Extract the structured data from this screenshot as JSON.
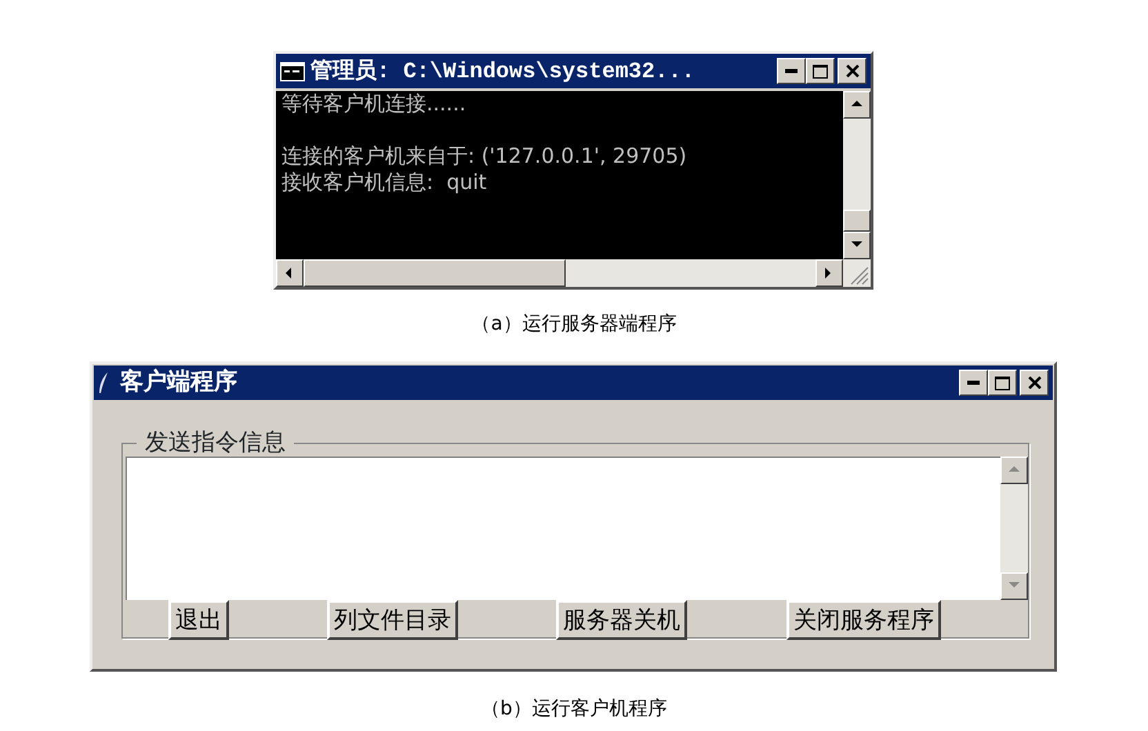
{
  "server_window": {
    "title": "管理员: C:\\Windows\\system32...",
    "console_blocks": [
      [
        "等待客户机连接......"
      ],
      [
        "连接的客户机来自于: ('127.0.0.1', 29705)",
        "接收客户机信息:  quit"
      ]
    ]
  },
  "server_caption": "（a）运行服务器端程序",
  "client_window": {
    "title": "客户端程序",
    "group_label": "发送指令信息",
    "buttons": [
      "退出",
      "列文件目录",
      "服务器关机",
      "关闭服务程序"
    ]
  },
  "client_caption": "（b）运行客户机程序"
}
